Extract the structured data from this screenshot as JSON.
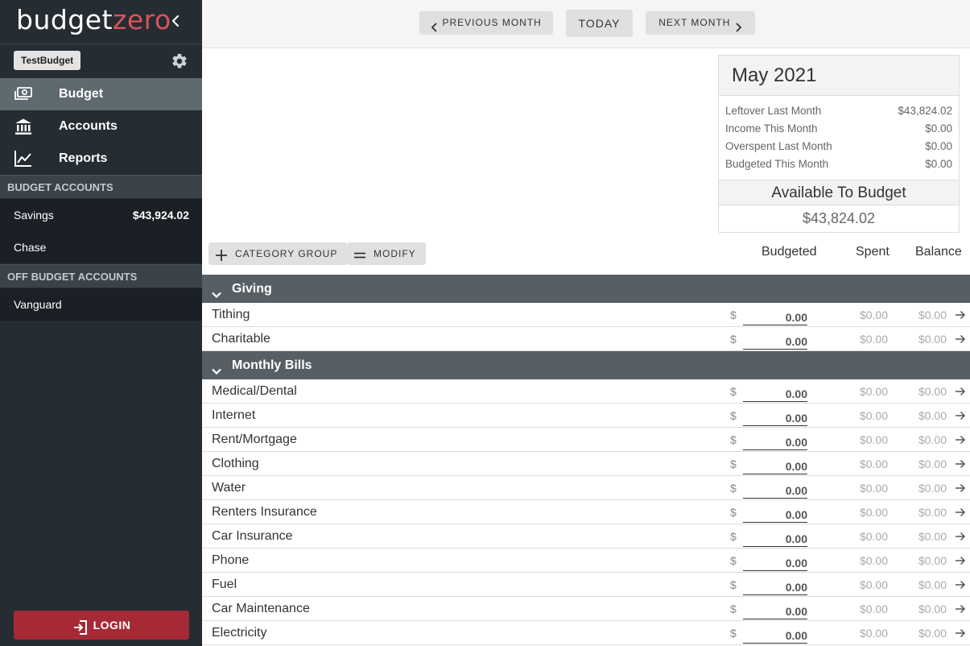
{
  "sidebar": {
    "logo_part1": "budget",
    "logo_part2": "zero",
    "budget_name": "TestBudget",
    "nav": [
      {
        "label": "Budget",
        "icon": "money-icon",
        "active": true
      },
      {
        "label": "Accounts",
        "icon": "bank-icon",
        "active": false
      },
      {
        "label": "Reports",
        "icon": "chart-line-icon",
        "active": false
      }
    ],
    "budget_accounts_header": "BUDGET ACCOUNTS",
    "budget_accounts": [
      {
        "name": "Savings",
        "balance": "$43,924.02"
      },
      {
        "name": "Chase",
        "balance": ""
      }
    ],
    "off_budget_header": "OFF BUDGET ACCOUNTS",
    "off_budget_accounts": [
      {
        "name": "Vanguard"
      }
    ],
    "login_label": "LOGIN"
  },
  "topbar": {
    "prev_label": "PREVIOUS MONTH",
    "today_label": "TODAY",
    "next_label": "NEXT MONTH"
  },
  "month": {
    "title": "May 2021",
    "lines": [
      {
        "label": "Leftover Last Month",
        "value": "$43,824.02"
      },
      {
        "label": "Income This Month",
        "value": "$0.00"
      },
      {
        "label": "Overspent Last Month",
        "value": "$0.00"
      },
      {
        "label": "Budgeted This Month",
        "value": "$0.00"
      }
    ],
    "atb_label": "Available To Budget",
    "atb_value": "$43,824.02"
  },
  "toolbar": {
    "category_group_label": "CATEGORY GROUP",
    "modify_label": "MODIFY"
  },
  "columns": {
    "budgeted": "Budgeted",
    "spent": "Spent",
    "balance": "Balance"
  },
  "groups": [
    {
      "name": "Giving",
      "categories": [
        {
          "name": "Tithing",
          "currency": "$",
          "budgeted": "0.00",
          "spent": "$0.00",
          "balance": "$0.00"
        },
        {
          "name": "Charitable",
          "currency": "$",
          "budgeted": "0.00",
          "spent": "$0.00",
          "balance": "$0.00"
        }
      ]
    },
    {
      "name": "Monthly Bills",
      "categories": [
        {
          "name": "Medical/Dental",
          "currency": "$",
          "budgeted": "0.00",
          "spent": "$0.00",
          "balance": "$0.00"
        },
        {
          "name": "Internet",
          "currency": "$",
          "budgeted": "0.00",
          "spent": "$0.00",
          "balance": "$0.00"
        },
        {
          "name": "Rent/Mortgage",
          "currency": "$",
          "budgeted": "0.00",
          "spent": "$0.00",
          "balance": "$0.00"
        },
        {
          "name": "Clothing",
          "currency": "$",
          "budgeted": "0.00",
          "spent": "$0.00",
          "balance": "$0.00"
        },
        {
          "name": "Water",
          "currency": "$",
          "budgeted": "0.00",
          "spent": "$0.00",
          "balance": "$0.00"
        },
        {
          "name": "Renters Insurance",
          "currency": "$",
          "budgeted": "0.00",
          "spent": "$0.00",
          "balance": "$0.00"
        },
        {
          "name": "Car Insurance",
          "currency": "$",
          "budgeted": "0.00",
          "spent": "$0.00",
          "balance": "$0.00"
        },
        {
          "name": "Phone",
          "currency": "$",
          "budgeted": "0.00",
          "spent": "$0.00",
          "balance": "$0.00"
        },
        {
          "name": "Fuel",
          "currency": "$",
          "budgeted": "0.00",
          "spent": "$0.00",
          "balance": "$0.00"
        },
        {
          "name": "Car Maintenance",
          "currency": "$",
          "budgeted": "0.00",
          "spent": "$0.00",
          "balance": "$0.00"
        },
        {
          "name": "Electricity",
          "currency": "$",
          "budgeted": "0.00",
          "spent": "$0.00",
          "balance": "$0.00"
        }
      ]
    }
  ]
}
